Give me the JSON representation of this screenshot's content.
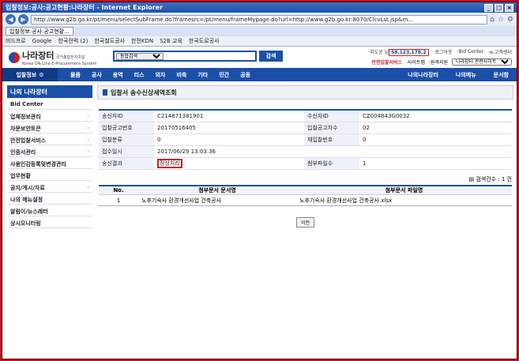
{
  "browser": {
    "window_title": "입찰정보:공사:공고현황:나라장터 - Internet Explorer",
    "url": "http://www.g2b.go.kr/pt/menu/selectSubFrame.do?framesrc=/pt/menu/frameMypage.do?url=http://www.g2b.go.kr:8070/ClcvLst.jsp&m...",
    "tab_label": "입찰정보:공사:공고현황...",
    "favorites": [
      "비드프로",
      "Google",
      "한국전력 (2)",
      "한국철도공사",
      "한전KDN",
      "S2B 교육",
      "한국도로공사"
    ]
  },
  "header": {
    "logo_name": "나라장터",
    "logo_tag": "국가종합전자조달",
    "logo_sub": "Korea ON-Line E-Procurement System",
    "search_select": "통합검색",
    "search_button": "검색",
    "counter_label": "·지도공 님",
    "counter_value": "58,123,178,2",
    "links": [
      "·로그아웃",
      "·Bid Center",
      "·e-고객센터"
    ],
    "row2_red": "안전입찰서비스",
    "row2_links": [
      "·사이트맵",
      "·원격지원"
    ],
    "related_select": "나라장터 관련사이트"
  },
  "gnb": {
    "first": "입찰정보",
    "items": [
      "물품",
      "공사",
      "용역",
      "리스",
      "외자",
      "비축",
      "기타",
      "민간",
      "공동"
    ],
    "right": [
      "나의나라장터",
      "나의메뉴",
      "문서함"
    ]
  },
  "sidebar": {
    "title": "나의 나라장터",
    "items": [
      {
        "label": "Bid Center",
        "arrow": false
      },
      {
        "label": "업체정보관리",
        "arrow": true
      },
      {
        "label": "자문보안토큰",
        "arrow": true
      },
      {
        "label": "안전입찰서비스",
        "arrow": true
      },
      {
        "label": "인증서관리",
        "arrow": true
      },
      {
        "label": "사용인감등록및변경관리",
        "arrow": false
      },
      {
        "label": "업무현황",
        "arrow": false
      },
      {
        "label": "공지/게시/자료",
        "arrow": true
      },
      {
        "label": "나의 메뉴설정",
        "arrow": false
      },
      {
        "label": "알림이/뉴스레터",
        "arrow": false
      },
      {
        "label": "상시모니터링",
        "arrow": false
      }
    ]
  },
  "main": {
    "title": "입찰서 송수신상세역조회",
    "rows": [
      {
        "l1": "송신자ID",
        "v1": "C214871381901",
        "l2": "수신자ID",
        "v2": "CZ004843G0032"
      },
      {
        "l1": "입찰공고번호",
        "v1": "20170516405",
        "l2": "입찰공고차수",
        "v2": "02"
      },
      {
        "l1": "입찰분류",
        "v1": "0",
        "l2": "재입찰번호",
        "v2": "0"
      },
      {
        "l1": "접수일시",
        "v1": "2017/06/29 13:03:36",
        "l2": "",
        "v2": ""
      },
      {
        "l1": "송신결과",
        "v1": "정상처리",
        "l2": "첨부파일수",
        "v2": "1"
      }
    ],
    "count_text": "검색건수 : 1 건",
    "att_headers": [
      "No.",
      "첨부문서 문서명",
      "첨부문서 파일명"
    ],
    "att_rows": [
      {
        "no": "1",
        "doc": "노후기숙사 환경개선사업 건축공사",
        "file": "노후기숙사 환경개선사업 건축공사.xlsx"
      }
    ],
    "back_button": "이전"
  }
}
